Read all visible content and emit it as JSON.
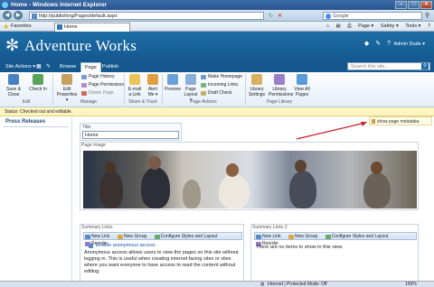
{
  "browser": {
    "title": "Home - Windows Internet Explorer",
    "url": "http://publishing/Pages/default.aspx",
    "search_placeholder": "Google",
    "favorites_label": "Favorites",
    "tab_label": "Home",
    "tools": [
      "Page ▾",
      "Safety ▾",
      "Tools ▾",
      "?"
    ],
    "status_zone": "Internet | Protected Mode: Off",
    "zoom": "100%"
  },
  "header": {
    "brand": "Adventure Works",
    "user": "Admin Dude ▾"
  },
  "ribbon_tabs": {
    "site_actions": "Site Actions ▾",
    "browse": "Browse",
    "page": "Page",
    "publish": "Publish",
    "search_placeholder": "Search this site..."
  },
  "ribbon": {
    "save_close": "Save & Close",
    "check_in": "Check In",
    "edit_properties": "Edit Properties ▾",
    "page_history": "Page History",
    "page_permissions": "Page Permissions",
    "delete_page": "Delete Page",
    "email_link": "E-mail a Link",
    "alert_me": "Alert Me ▾",
    "preview": "Preview",
    "page_layout": "Page Layout ▾",
    "make_homepage": "Make Homepage",
    "incoming_links": "Incoming Links",
    "draft_check": "Draft Check",
    "library_settings": "Library Settings",
    "library_permissions": "Library Permissions",
    "view_all_pages": "View All Pages",
    "groups": {
      "edit": "Edit",
      "manage": "Manage",
      "share": "Share & Track",
      "page_actions": "Page Actions",
      "page_library": "Page Library"
    }
  },
  "status_bar": "Status: Checked out and editable.",
  "left_nav": {
    "heading": "Press Releases"
  },
  "show_metadata": "show page metadata",
  "title_field": {
    "label": "Title",
    "value": "Home"
  },
  "page_image": {
    "label": "Page Image"
  },
  "summary1": {
    "label": "Summary Links",
    "toolbar": [
      "New Link",
      "New Group",
      "Configure Styles and Layout",
      "Reorder"
    ],
    "link": "Enable anonymous access",
    "text": "Anonymous access allows users to view the pages on this site without logging in. This is useful when creating internet facing sites or sites where you want everyone to have access to read the content without editing."
  },
  "summary2": {
    "label": "Summary Links 2",
    "toolbar": [
      "New Link",
      "New Group",
      "Configure Styles and Layout",
      "Reorder"
    ],
    "empty": "There are no items to show in this view."
  },
  "colors": {
    "header_blue": "#1d6ea8",
    "status_yellow": "#fdf5c0",
    "arrow_red": "#c0202a"
  }
}
